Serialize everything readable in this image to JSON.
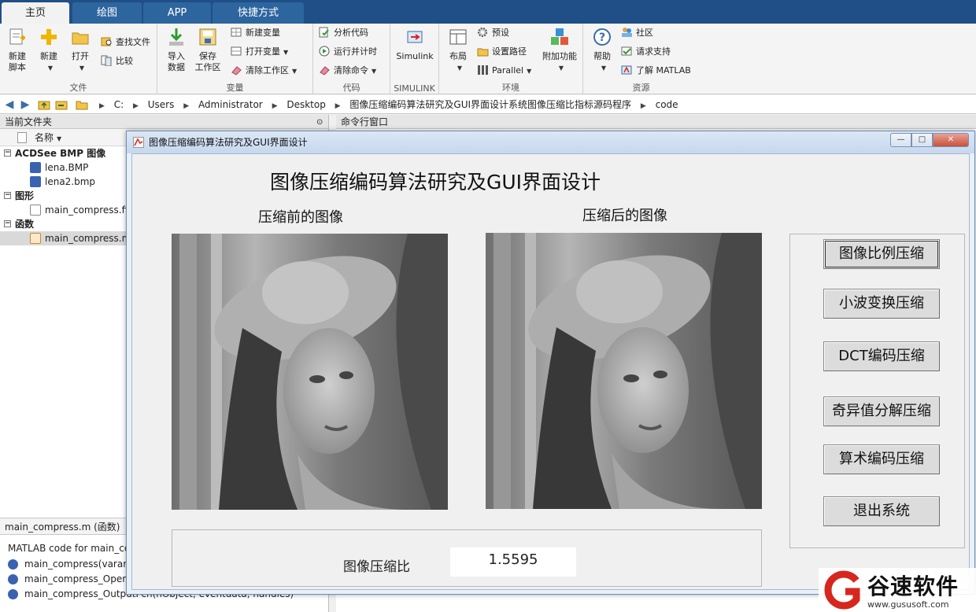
{
  "tabs": [
    {
      "label": "主页",
      "active": true
    },
    {
      "label": "绘图",
      "active": false
    },
    {
      "label": "APP",
      "active": false
    },
    {
      "label": "快捷方式",
      "active": false
    }
  ],
  "ribbon": {
    "file_group": {
      "label": "文件",
      "new_script": "新建\n脚本",
      "new": "新建",
      "open": "打开",
      "find_files": "查找文件",
      "compare": "比较"
    },
    "variable_group": {
      "label": "变量",
      "import_data": "导入\n数据",
      "save_workspace": "保存\n工作区",
      "new_variable": "新建变量",
      "open_variable": "打开变量",
      "clear_workspace": "清除工作区"
    },
    "code_group": {
      "label": "代码",
      "analyze_code": "分析代码",
      "run_and_time": "运行并计时",
      "clear_commands": "清除命令"
    },
    "simulink_group": {
      "label": "SIMULINK",
      "simulink": "Simulink"
    },
    "environment_group": {
      "label": "环境",
      "layout": "布局",
      "preferences": "预设",
      "set_path": "设置路径",
      "parallel": "Parallel",
      "add_ons": "附加功能"
    },
    "resources_group": {
      "label": "资源",
      "help": "帮助",
      "community": "社区",
      "request_support": "请求支持",
      "learn_matlab": "了解 MATLAB"
    }
  },
  "address": {
    "crumbs": [
      "C:",
      "Users",
      "Administrator",
      "Desktop",
      "图像压缩编码算法研究及GUI界面设计系统图像压缩比指标源码程序",
      "code"
    ]
  },
  "file_panel": {
    "title": "当前文件夹",
    "column_name": "名称",
    "groups": [
      {
        "label": "ACDSee BMP 图像",
        "files": [
          "lena.BMP",
          "lena2.bmp"
        ]
      },
      {
        "label": "图形",
        "files": [
          "main_compress.fig"
        ]
      },
      {
        "label": "函数",
        "files": [
          "main_compress.m"
        ]
      }
    ],
    "detail_title": "main_compress.m  (函数)",
    "detail_desc": "MATLAB code for main_compress.fig",
    "functions": [
      "main_compress(varargin)",
      "main_compress_OpeningFcn(hObject, eventdata, handles, varargin)",
      "main_compress_OutputFcn(hObject, eventdata, handles)"
    ]
  },
  "command_window": {
    "title": "命令行窗口"
  },
  "figure": {
    "window_title": "图像压缩编码算法研究及GUI界面设计",
    "gui_title": "图像压缩编码算法研究及GUI界面设计",
    "caption_before": "压缩前的图像",
    "caption_after": "压缩后的图像",
    "ratio_label": "图像压缩比",
    "ratio_value": "1.5595",
    "buttons": [
      "图像比例压缩",
      "小波变换压缩",
      "DCT编码压缩",
      "奇异值分解压缩",
      "算术编码压缩",
      "退出系统"
    ]
  },
  "watermark": {
    "name": "谷速软件",
    "url": "www.gususoft.com"
  },
  "colors": {
    "tabbar": "#1f4f86",
    "logo_red": "#d7261e"
  }
}
